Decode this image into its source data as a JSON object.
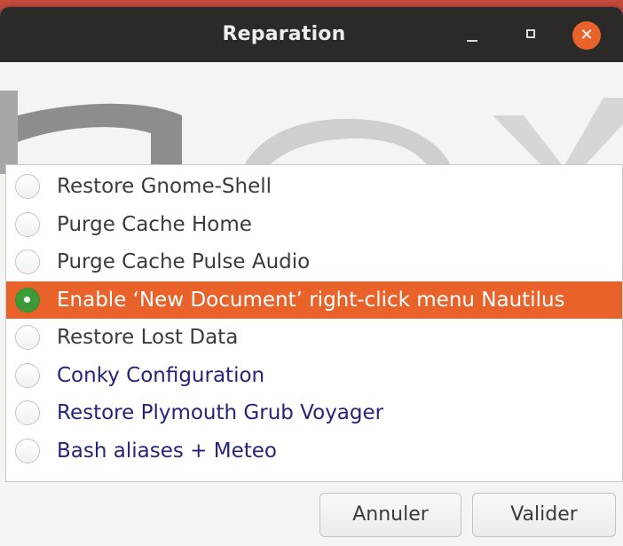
{
  "window": {
    "title": "Reparation"
  },
  "options": [
    {
      "label": "Restore Gnome-Shell",
      "selected": false,
      "style": "normal"
    },
    {
      "label": "Purge Cache Home",
      "selected": false,
      "style": "normal"
    },
    {
      "label": "Purge Cache Pulse Audio",
      "selected": false,
      "style": "normal"
    },
    {
      "label": "Enable ‘New Document’ right-click menu Nautilus",
      "selected": true,
      "style": "normal"
    },
    {
      "label": "Restore Lost Data",
      "selected": false,
      "style": "normal"
    },
    {
      "label": "Conky Configuration",
      "selected": false,
      "style": "link"
    },
    {
      "label": "Restore Plymouth Grub Voyager",
      "selected": false,
      "style": "link"
    },
    {
      "label": "Bash aliases + Meteo",
      "selected": false,
      "style": "link"
    }
  ],
  "buttons": {
    "cancel": "Annuler",
    "ok": "Valider"
  },
  "colors": {
    "selection": "#e9622a",
    "titlebar": "#2b2a29",
    "radio_checked": "#3c9a37",
    "link_text": "#24257a"
  }
}
